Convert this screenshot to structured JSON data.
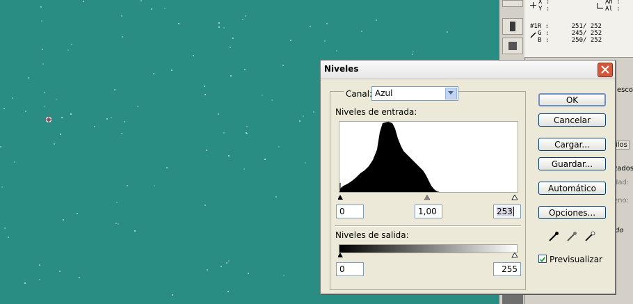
{
  "dialog": {
    "title": "Niveles",
    "channel_label": "Canal:",
    "channel_value": "Azul",
    "input_levels_label": "Niveles de entrada:",
    "input_black": "0",
    "input_gamma": "1,00",
    "input_white": "253",
    "output_levels_label": "Niveles de salida:",
    "output_black": "0",
    "output_white": "255",
    "buttons": {
      "ok": "OK",
      "cancel": "Cancelar",
      "load": "Cargar...",
      "save": "Guardar...",
      "auto": "Automático",
      "options": "Opciones..."
    },
    "preview_label": "Previsualizar",
    "preview_checked": true
  },
  "info_panel": {
    "x_label": "X :",
    "y_label": "Y :",
    "width_label": "An :",
    "height_label": "Al :",
    "r_line": "#1R :      251/ 252",
    "g_line": "G :      245/ 252",
    "b_line": "B :      250/ 252"
  },
  "side_fragments": {
    "esco": "esco",
    "tilos": "tilos",
    "zados": "zados",
    "dad": "dad:",
    "eno": "eno:",
    "do": "do"
  },
  "colors": {
    "canvas": "#2a8d83",
    "dialog_bg": "#ece9d8",
    "close_button": "#d35a3d"
  }
}
